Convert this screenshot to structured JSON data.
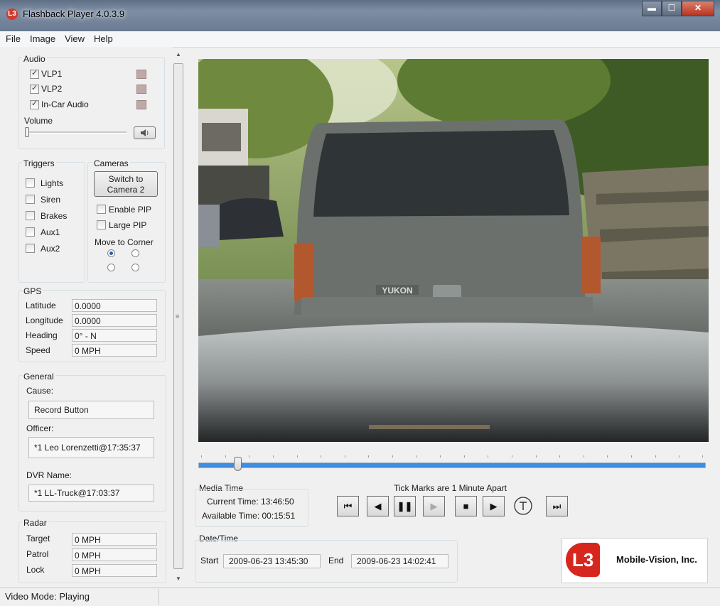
{
  "window": {
    "title": "Flashback Player 4.0.3.9",
    "app_icon": "L3",
    "minimize": "▬",
    "maximize": "☐",
    "close": "✕"
  },
  "menu": [
    "File",
    "Image",
    "View",
    "Help"
  ],
  "audio": {
    "label": "Audio",
    "channels": [
      {
        "label": "VLP1",
        "checked": true
      },
      {
        "label": "VLP2",
        "checked": true
      },
      {
        "label": "In-Car Audio",
        "checked": true
      }
    ],
    "volume_label": "Volume"
  },
  "triggers": {
    "label": "Triggers",
    "items": [
      "Lights",
      "Siren",
      "Brakes",
      "Aux1",
      "Aux2"
    ]
  },
  "cameras": {
    "label": "Cameras",
    "switch_line1": "Switch to",
    "switch_line2": "Camera 2",
    "enable_pip": "Enable PIP",
    "large_pip": "Large PIP",
    "move_to_corner": "Move to Corner"
  },
  "gps": {
    "label": "GPS",
    "rows": [
      {
        "label": "Latitude",
        "value": "0.0000"
      },
      {
        "label": "Longitude",
        "value": "0.0000"
      },
      {
        "label": "Heading",
        "value": "0° - N"
      },
      {
        "label": "Speed",
        "value": "0 MPH"
      }
    ]
  },
  "general": {
    "label": "General",
    "cause_label": "Cause:",
    "cause": "Record Button",
    "officer_label": "Officer:",
    "officer": "*1 Leo Lorenzetti@17:35:37",
    "dvr_label": "DVR Name:",
    "dvr": "*1 LL-Truck@17:03:37"
  },
  "radar": {
    "label": "Radar",
    "rows": [
      {
        "label": "Target",
        "value": "0 MPH"
      },
      {
        "label": "Patrol",
        "value": "0 MPH"
      },
      {
        "label": "Lock",
        "value": "0 MPH"
      }
    ]
  },
  "media": {
    "label": "Media Time",
    "current": "Current Time: 13:46:50",
    "available": "Available Time: 00:15:51",
    "tick_note": "Tick Marks are 1 Minute Apart"
  },
  "datetime": {
    "label": "Date/Time",
    "start_label": "Start",
    "start": "2009-06-23 13:45:30",
    "end_label": "End",
    "end": "2009-06-23 14:02:41"
  },
  "timeline": {
    "position_fraction": 0.07
  },
  "video": {
    "plate_text": "YUKON"
  },
  "logo": {
    "mark": "L3",
    "text": "Mobile-Vision, Inc."
  },
  "status": "Video Mode: Playing",
  "colors": {
    "timeline_fill": "#3d8de0",
    "logo_red": "#d6261e"
  }
}
